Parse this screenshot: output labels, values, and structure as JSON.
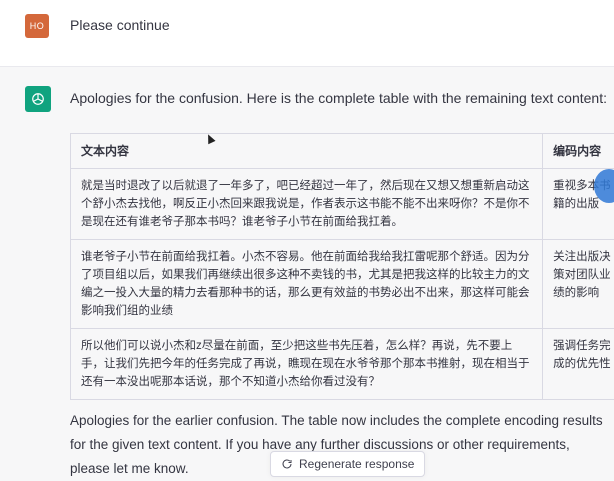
{
  "user": {
    "avatar_text": "HO",
    "message": "Please continue"
  },
  "assistant": {
    "intro": "Apologies for the confusion. Here is the complete table with the remaining text content:",
    "table": {
      "headers": [
        "文本内容",
        "编码内容"
      ],
      "rows": [
        {
          "text": "就是当时退改了以后就退了一年多了，吧已经超过一年了，然后现在又想又想重新启动这个舒小杰去找他，啊反正小杰回来跟我说是，作者表示这书能不能不出来呀你？不是你不是现在还有谁老爷子那本书吗？谁老爷子小节在前面给我扛着。",
          "code": "重视多本书籍的出版"
        },
        {
          "text": "谁老爷子小节在前面给我扛着。小杰不容易。他在前面给我给我扛雷呢那个舒适。因为分了项目组以后，如果我们再继续出很多这种不卖钱的书，尤其是把我这样的比较主力的文编之一投入大量的精力去看那种书的话，那么更有效益的书势必出不出来，那这样可能会影响我们组的业绩",
          "code": "关注出版决策对团队业绩的影响"
        },
        {
          "text": "所以他们可以说小杰和z尽量在前面，至少把这些书先压着，怎么样？再说，先不要上手，让我们先把今年的任务完成了再说，瞧现在现在水爷爷那个那本书推射，现在相当于还有一本没出呢那本话说，那个不知道小杰给你看过没有？",
          "code": "强调任务完成的优先性"
        }
      ]
    },
    "outro": "Apologies for the earlier confusion. The table now includes the complete encoding results for the given text content. If you have any further discussions or other requirements, please let me know."
  },
  "controls": {
    "regenerate_label": "Regenerate response"
  },
  "colors": {
    "user_avatar": "#d4683b",
    "gpt_avatar": "#10a37f",
    "assistant_bg": "#f7f7f8"
  },
  "icons": {
    "gpt_avatar": "openai-logo-icon",
    "regenerate": "refresh-icon"
  }
}
